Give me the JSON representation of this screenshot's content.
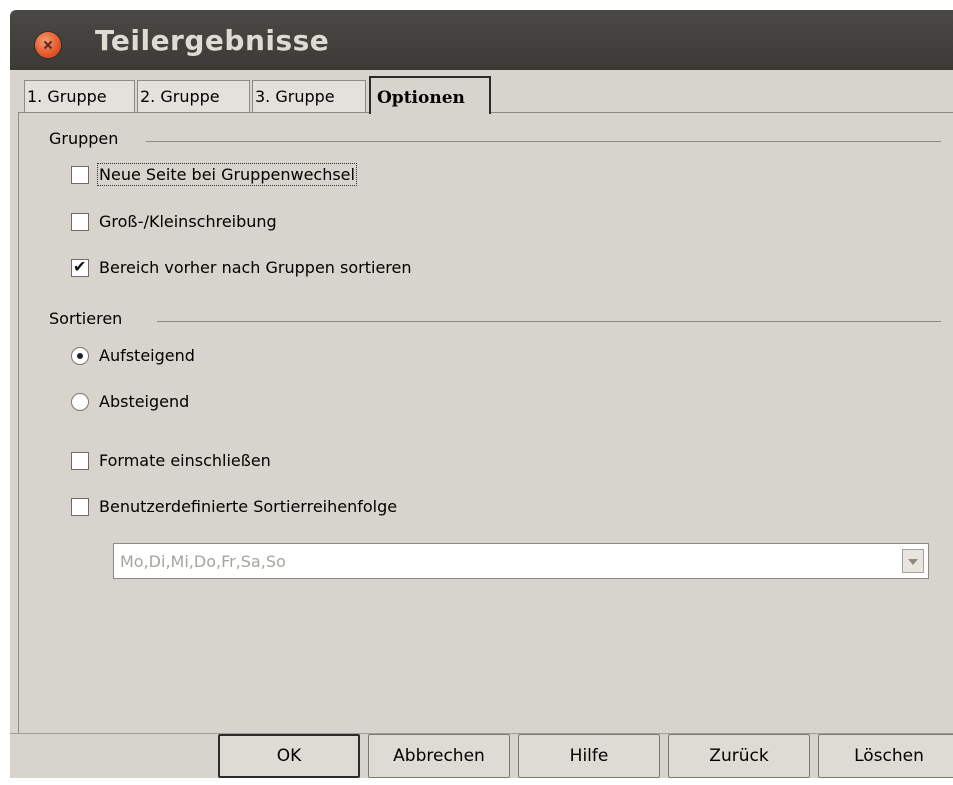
{
  "window": {
    "title": "Teilergebnisse"
  },
  "tabs": [
    {
      "label": "1. Gruppe"
    },
    {
      "label": "2. Gruppe"
    },
    {
      "label": "3. Gruppe"
    },
    {
      "label": "Optionen",
      "active": true
    }
  ],
  "groups": {
    "section_label": "Gruppen",
    "page_break": {
      "label": "Neue Seite bei Gruppenwechsel",
      "checked": false
    },
    "case_sensitive": {
      "label": "Groß-/Kleinschreibung",
      "checked": false
    },
    "presort": {
      "label": "Bereich vorher nach Gruppen sortieren",
      "checked": true
    }
  },
  "sort": {
    "section_label": "Sortieren",
    "ascending": {
      "label": "Aufsteigend",
      "selected": true
    },
    "descending": {
      "label": "Absteigend",
      "selected": false
    },
    "include_formats": {
      "label": "Formate einschließen",
      "checked": false
    },
    "custom_order": {
      "label": "Benutzerdefinierte Sortierreihenfolge",
      "checked": false
    },
    "custom_order_value": "Mo,Di,Mi,Do,Fr,Sa,So"
  },
  "buttons": {
    "ok": "OK",
    "cancel": "Abbrechen",
    "help": "Hilfe",
    "back": "Zurück",
    "delete": "Löschen"
  },
  "icons": {
    "close": "close-icon",
    "dropdown": "chevron-down-icon"
  },
  "colors": {
    "titlebar": "#3e3d39",
    "dialog_bg": "#d7d3cd",
    "close": "#e2572a"
  }
}
